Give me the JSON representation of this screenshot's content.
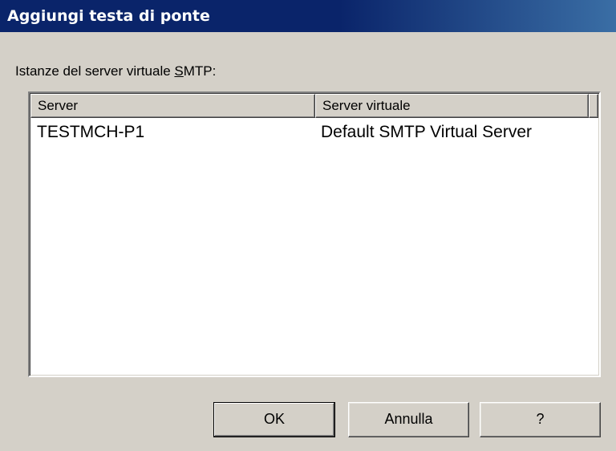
{
  "window": {
    "title": "Aggiungi testa di ponte"
  },
  "list": {
    "label_before": "Istanze del server virtuale ",
    "label_mnemonic": "S",
    "label_after": "MTP:",
    "columns": [
      "Server",
      "Server virtuale"
    ],
    "rows": [
      {
        "server": "TESTMCH-P1",
        "virtual_server": "Default SMTP Virtual Server"
      }
    ]
  },
  "buttons": {
    "ok": "OK",
    "cancel": "Annulla",
    "help": "?"
  }
}
